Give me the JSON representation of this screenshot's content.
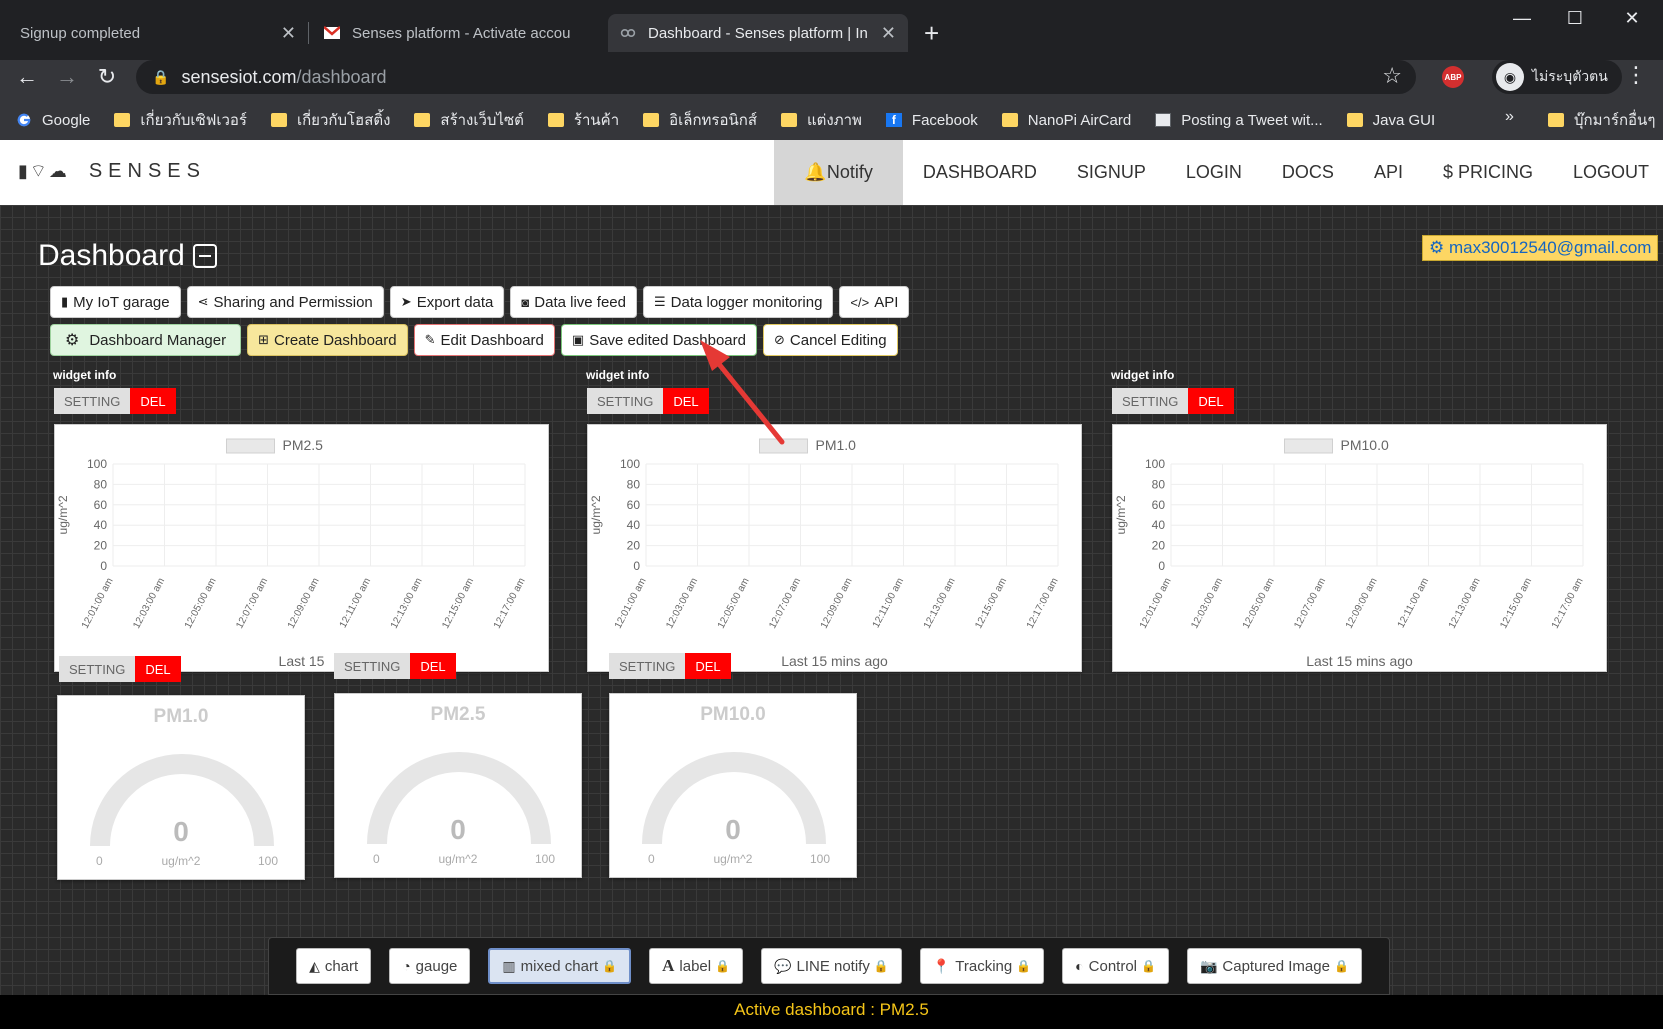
{
  "browser": {
    "tabs": [
      {
        "title": "Signup completed"
      },
      {
        "title": "Senses platform - Activate accou"
      },
      {
        "title": "Dashboard - Senses platform | In"
      }
    ],
    "url_host": "sensesiot.com",
    "url_path": "/dashboard",
    "profile_label": "ไม่ระบุตัวตน",
    "abp_label": "ABP",
    "bookmarks": [
      {
        "label": "Google",
        "icon": "google-icon"
      },
      {
        "label": "เกี่ยวกับเซิฟเวอร์",
        "icon": "folder-icon"
      },
      {
        "label": "เกี่ยวกับโฮสติ้ง",
        "icon": "folder-icon"
      },
      {
        "label": "สร้างเว็บไซต์",
        "icon": "folder-icon"
      },
      {
        "label": "ร้านค้า",
        "icon": "folder-icon"
      },
      {
        "label": "อิเล็กทรอนิกส์",
        "icon": "folder-icon"
      },
      {
        "label": "แต่งภาพ",
        "icon": "folder-icon"
      },
      {
        "label": "Facebook",
        "icon": "facebook-icon"
      },
      {
        "label": "NanoPi AirCard",
        "icon": "folder-icon"
      },
      {
        "label": "Posting a Tweet wit...",
        "icon": "page-icon"
      },
      {
        "label": "Java GUI",
        "icon": "folder-icon"
      }
    ],
    "bookmarks_more": "»",
    "other_bookmarks": "บุ๊กมาร์กอื่นๆ"
  },
  "site": {
    "brand": "SENSES",
    "nav": {
      "notify": "Notify",
      "dashboard": "DASHBOARD",
      "signup": "SIGNUP",
      "login": "LOGIN",
      "docs": "DOCS",
      "api": "API",
      "pricing": "$ PRICING",
      "logout": "LOGOUT"
    }
  },
  "dashboard": {
    "title": "Dashboard",
    "user_email": "max30012540@gmail.com",
    "row1": {
      "garage": "My IoT garage",
      "sharing": "Sharing and Permission",
      "export": "Export data",
      "livefeed": "Data live feed",
      "logger": "Data logger monitoring",
      "api": "API"
    },
    "row2": {
      "manager": "Dashboard Manager",
      "create": "Create Dashboard",
      "edit": "Edit Dashboard",
      "save": "Save edited Dashboard",
      "cancel": "Cancel Editing"
    },
    "widget_info": "widget info",
    "setting": "SETTING",
    "del": "DEL",
    "chart_footer_full": "Last 15 mins ago",
    "chart_footer_short": "Last 15",
    "gauge_unit": "ug/m^2",
    "gauge_min": "0",
    "gauge_max": "100",
    "gauges": [
      {
        "title": "PM1.0",
        "value": "0"
      },
      {
        "title": "PM2.5",
        "value": "0"
      },
      {
        "title": "PM10.0",
        "value": "0"
      }
    ],
    "widget_bar": {
      "chart": "chart",
      "gauge": "gauge",
      "mixed": "mixed chart",
      "label": "label",
      "line": "LINE notify",
      "tracking": "Tracking",
      "control": "Control",
      "captured": "Captured Image"
    },
    "active_dashboard": "Active dashboard : PM2.5"
  },
  "chart_data": [
    {
      "type": "line",
      "series": [
        {
          "name": "PM2.5",
          "values": []
        }
      ],
      "categories": [
        "12:01:00 am",
        "12:03:00 am",
        "12:05:00 am",
        "12:07:00 am",
        "12:09:00 am",
        "12:11:00 am",
        "12:13:00 am",
        "12:15:00 am",
        "12:17:00 am"
      ],
      "ylabel": "ug/m^2",
      "ylim": [
        0,
        100
      ],
      "yticks": [
        0,
        20,
        40,
        60,
        80,
        100
      ],
      "grid": true,
      "legend": "top-center"
    },
    {
      "type": "line",
      "series": [
        {
          "name": "PM1.0",
          "values": []
        }
      ],
      "categories": [
        "12:01:00 am",
        "12:03:00 am",
        "12:05:00 am",
        "12:07:00 am",
        "12:09:00 am",
        "12:11:00 am",
        "12:13:00 am",
        "12:15:00 am",
        "12:17:00 am"
      ],
      "ylabel": "ug/m^2",
      "ylim": [
        0,
        100
      ],
      "yticks": [
        0,
        20,
        40,
        60,
        80,
        100
      ],
      "grid": true,
      "legend": "top-center"
    },
    {
      "type": "line",
      "series": [
        {
          "name": "PM10.0",
          "values": []
        }
      ],
      "categories": [
        "12:01:00 am",
        "12:03:00 am",
        "12:05:00 am",
        "12:07:00 am",
        "12:09:00 am",
        "12:11:00 am",
        "12:13:00 am",
        "12:15:00 am",
        "12:17:00 am"
      ],
      "ylabel": "ug/m^2",
      "ylim": [
        0,
        100
      ],
      "yticks": [
        0,
        20,
        40,
        60,
        80,
        100
      ],
      "grid": true,
      "legend": "top-center"
    }
  ],
  "colors": {
    "notify_bg": "#d6d6d6",
    "del_bg": "#ff0000",
    "active_text": "#f5c518",
    "email_text": "#1565c0",
    "email_bg": "#fdd663",
    "arrow": "#e53935"
  }
}
